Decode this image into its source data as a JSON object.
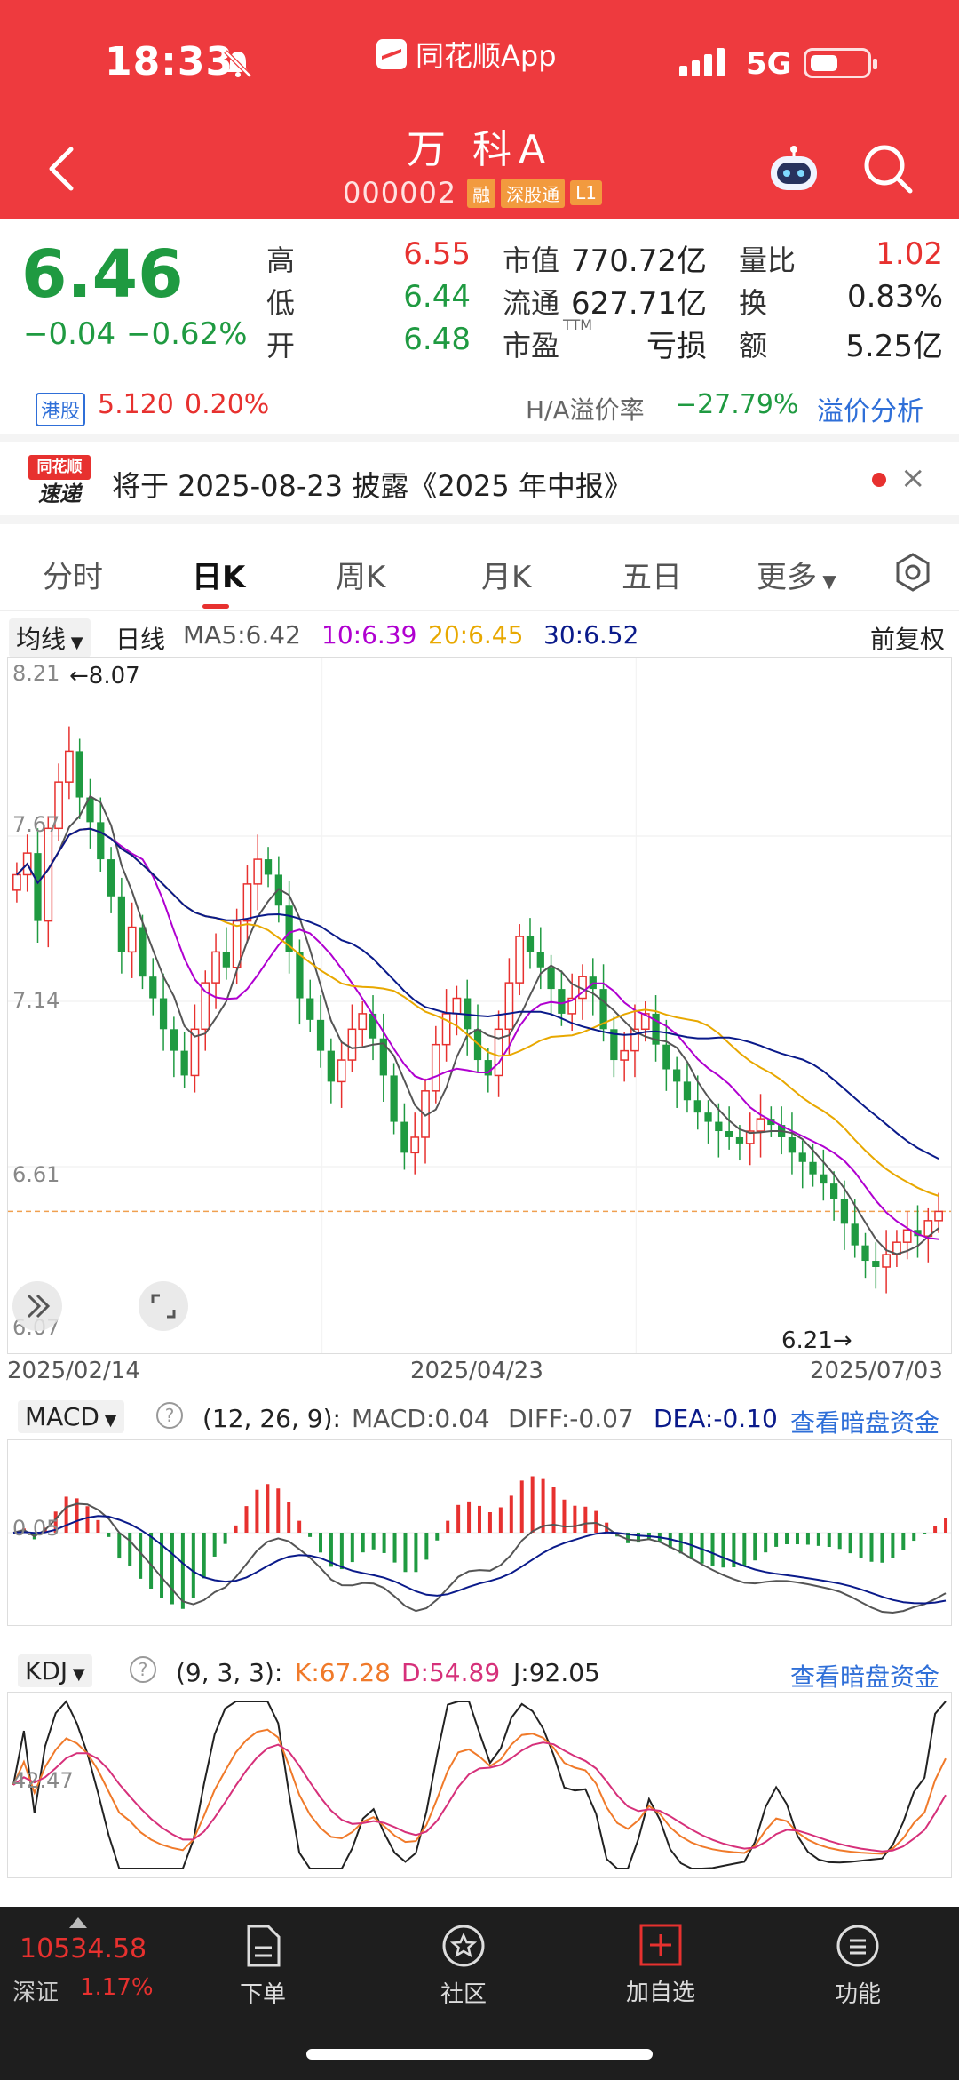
{
  "status": {
    "time": "18:33",
    "app_name": "同花顺App",
    "network": "5G"
  },
  "stock": {
    "name": "万 科A",
    "code": "000002",
    "tags": [
      "融",
      "深股通",
      "L1"
    ]
  },
  "quote": {
    "price": "6.46",
    "change": "−0.04",
    "change_pct": "−0.62%",
    "high_label": "高",
    "high": "6.55",
    "low_label": "低",
    "low": "6.44",
    "open_label": "开",
    "open": "6.48",
    "mktcap_label": "市值",
    "mktcap": "770.72亿",
    "float_label": "流通",
    "float": "627.71亿",
    "pe_label": "市盈",
    "pe_sup": "TTM",
    "pe": "亏损",
    "volratio_label": "量比",
    "volratio": "1.02",
    "turnover_label": "换",
    "turnover": "0.83%",
    "amount_label": "额",
    "amount": "5.25亿"
  },
  "hk": {
    "badge": "港股",
    "price": "5.120",
    "pct": "0.20%",
    "ha_label": "H/A溢价率",
    "ha_value": "−27.79%",
    "link": "溢价分析"
  },
  "notice": {
    "logo_top": "同花顺",
    "logo_bottom": "速递",
    "text": "将于 2025-08-23 披露《2025 年中报》",
    "close": "×"
  },
  "tabs": [
    "分时",
    "日K",
    "周K",
    "月K",
    "五日",
    "更多"
  ],
  "ma": {
    "selector": "均线",
    "period": "日线",
    "ma5": "MA5:6.42",
    "ma10": "10:6.39",
    "ma20": "20:6.45",
    "ma30": "30:6.52",
    "fuquan": "前复权"
  },
  "kline": {
    "y_labels": [
      "8.21",
      "7.67",
      "7.14",
      "6.61",
      "6.07"
    ],
    "max_label": "←8.07",
    "min_label": "6.21→",
    "dates": [
      "2025/02/14",
      "2025/04/23",
      "2025/07/03"
    ]
  },
  "macd": {
    "selector": "MACD",
    "params": "(12, 26, 9):",
    "macd": "MACD:0.04",
    "diff": "DIFF:-0.07",
    "dea": "DEA:-0.10",
    "link": "查看暗盘资金",
    "y_label": "0.05"
  },
  "kdj": {
    "selector": "KDJ",
    "params": "(9, 3, 3):",
    "k": "K:67.28",
    "d": "D:54.89",
    "j": "J:92.05",
    "link": "查看暗盘资金",
    "y_label": "42.47"
  },
  "bottom": {
    "index_value": "10534.58",
    "index_name": "深证",
    "index_pct": "1.17%",
    "nav": [
      "下单",
      "社区",
      "加自选",
      "功能"
    ]
  },
  "colors": {
    "up": "#e7312f",
    "down": "#1f9a41",
    "header": "#ee3a3e",
    "link": "#2f6fd8"
  },
  "chart_data": {
    "type": "candlestick",
    "ylim": [
      6.07,
      8.21
    ],
    "start_date": "2025/02/14",
    "end_date": "2025/07/03",
    "close_start": 7.5,
    "close_end": 6.46,
    "closes": [
      7.55,
      7.62,
      7.4,
      7.7,
      7.85,
      7.95,
      7.8,
      7.72,
      7.6,
      7.48,
      7.3,
      7.38,
      7.22,
      7.15,
      7.05,
      6.98,
      6.9,
      7.05,
      7.2,
      7.3,
      7.25,
      7.4,
      7.52,
      7.6,
      7.55,
      7.45,
      7.3,
      7.15,
      7.08,
      6.98,
      6.88,
      6.95,
      7.05,
      7.1,
      7.02,
      6.9,
      6.75,
      6.65,
      6.7,
      6.85,
      7.0,
      7.1,
      7.15,
      7.05,
      6.95,
      6.9,
      7.05,
      7.2,
      7.35,
      7.3,
      7.25,
      7.18,
      7.1,
      7.15,
      7.22,
      7.18,
      7.05,
      6.95,
      6.98,
      7.05,
      7.1,
      7.0,
      6.92,
      6.88,
      6.82,
      6.78,
      6.75,
      6.72,
      6.7,
      6.68,
      6.72,
      6.76,
      6.74,
      6.7,
      6.65,
      6.62,
      6.58,
      6.55,
      6.5,
      6.42,
      6.35,
      6.3,
      6.28,
      6.32,
      6.36,
      6.4,
      6.38,
      6.43,
      6.46
    ]
  }
}
